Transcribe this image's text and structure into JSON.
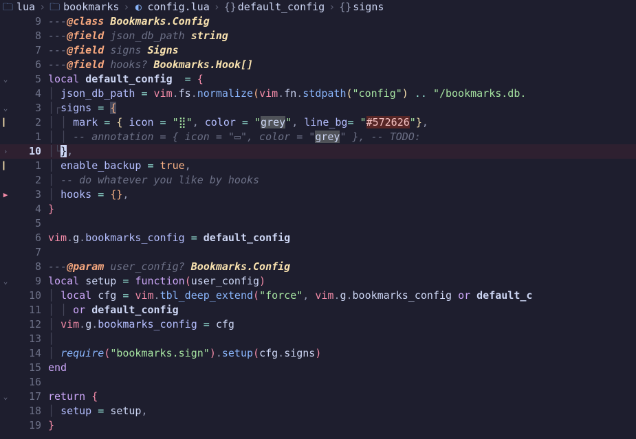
{
  "breadcrumb": {
    "items": [
      {
        "icon": "folder",
        "label": "lua"
      },
      {
        "icon": "folder",
        "label": "bookmarks"
      },
      {
        "icon": "lua",
        "label": "config.lua"
      },
      {
        "icon": "brace",
        "label": "default_config"
      },
      {
        "icon": "brace",
        "label": "signs"
      }
    ]
  },
  "cursor_line_display": "10",
  "lines": {
    "l1": {
      "num": "9"
    },
    "l2": {
      "num": "8"
    },
    "l3": {
      "num": "7"
    },
    "l4": {
      "num": "6"
    },
    "l5": {
      "num": "5"
    },
    "l6": {
      "num": "4"
    },
    "l7": {
      "num": "3"
    },
    "l8": {
      "num": "2"
    },
    "l9": {
      "num": "1"
    },
    "l10": {
      "num": "10"
    },
    "l11": {
      "num": "1"
    },
    "l12": {
      "num": "2"
    },
    "l13": {
      "num": "3"
    },
    "l14": {
      "num": "4"
    },
    "l15": {
      "num": "5"
    },
    "l16": {
      "num": "6"
    },
    "l17": {
      "num": "7"
    },
    "l18": {
      "num": "8"
    },
    "l19": {
      "num": "9"
    },
    "l20": {
      "num": "10"
    },
    "l21": {
      "num": "11"
    },
    "l22": {
      "num": "12"
    },
    "l23": {
      "num": "13"
    },
    "l24": {
      "num": "14"
    },
    "l25": {
      "num": "15"
    },
    "l26": {
      "num": "16"
    },
    "l27": {
      "num": "17"
    },
    "l28": {
      "num": "18"
    },
    "l29": {
      "num": "19"
    }
  },
  "tokens": {
    "class": "@class",
    "field_anno": "@field",
    "param_anno": "@param",
    "bookmarks_config": "Bookmarks.Config",
    "json_db_path": "json_db_path",
    "string_t": "string",
    "signs": "signs",
    "signs_t": "Signs",
    "hooks_q": "hooks?",
    "bookmarks_hook_arr": "Bookmarks.Hook[]",
    "local": "local",
    "default_config": "default_config",
    "eq": " = ",
    "lbrace": "{",
    "rbrace": "}",
    "vim": "vim",
    "fs": "fs",
    "fn": "fn",
    "normalize": "normalize",
    "stdpath": "stdpath",
    "config_str": "\"config\"",
    "concat": "..",
    "db_path_str": "\"/bookmarks.db.",
    "mark": "mark",
    "icon": "icon",
    "icon_glyph": "\"⣿\"",
    "color": "color",
    "grey": "grey",
    "line_bg": "line_bg",
    "hex_572626": "#572626",
    "annotation_cmt": "-- annotation = { icon = \"▭\", color = \"",
    "annotation_cmt2": "\" }, -- TODO:",
    "enable_backup": "enable_backup",
    "true": "true",
    "hooks_cmt": "-- do whatever you like by hooks",
    "hooks": "hooks",
    "g": "g",
    "bookmarks_config_g": "bookmarks_config",
    "user_config_q": "user_config?",
    "setup": "setup",
    "function": "function",
    "user_config": "user_config",
    "cfg": "cfg",
    "tbl_deep_extend": "tbl_deep_extend",
    "force_str": "\"force\"",
    "or": "or",
    "default_c_trunc": "default_c",
    "require": "require",
    "bm_sign_str": "\"bookmarks.sign\"",
    "end": "end",
    "return": "return",
    "comma": ",",
    "dot": ".",
    "lparen": "(",
    "rparen": ")",
    "quote": "\"",
    "dash3": "---"
  }
}
